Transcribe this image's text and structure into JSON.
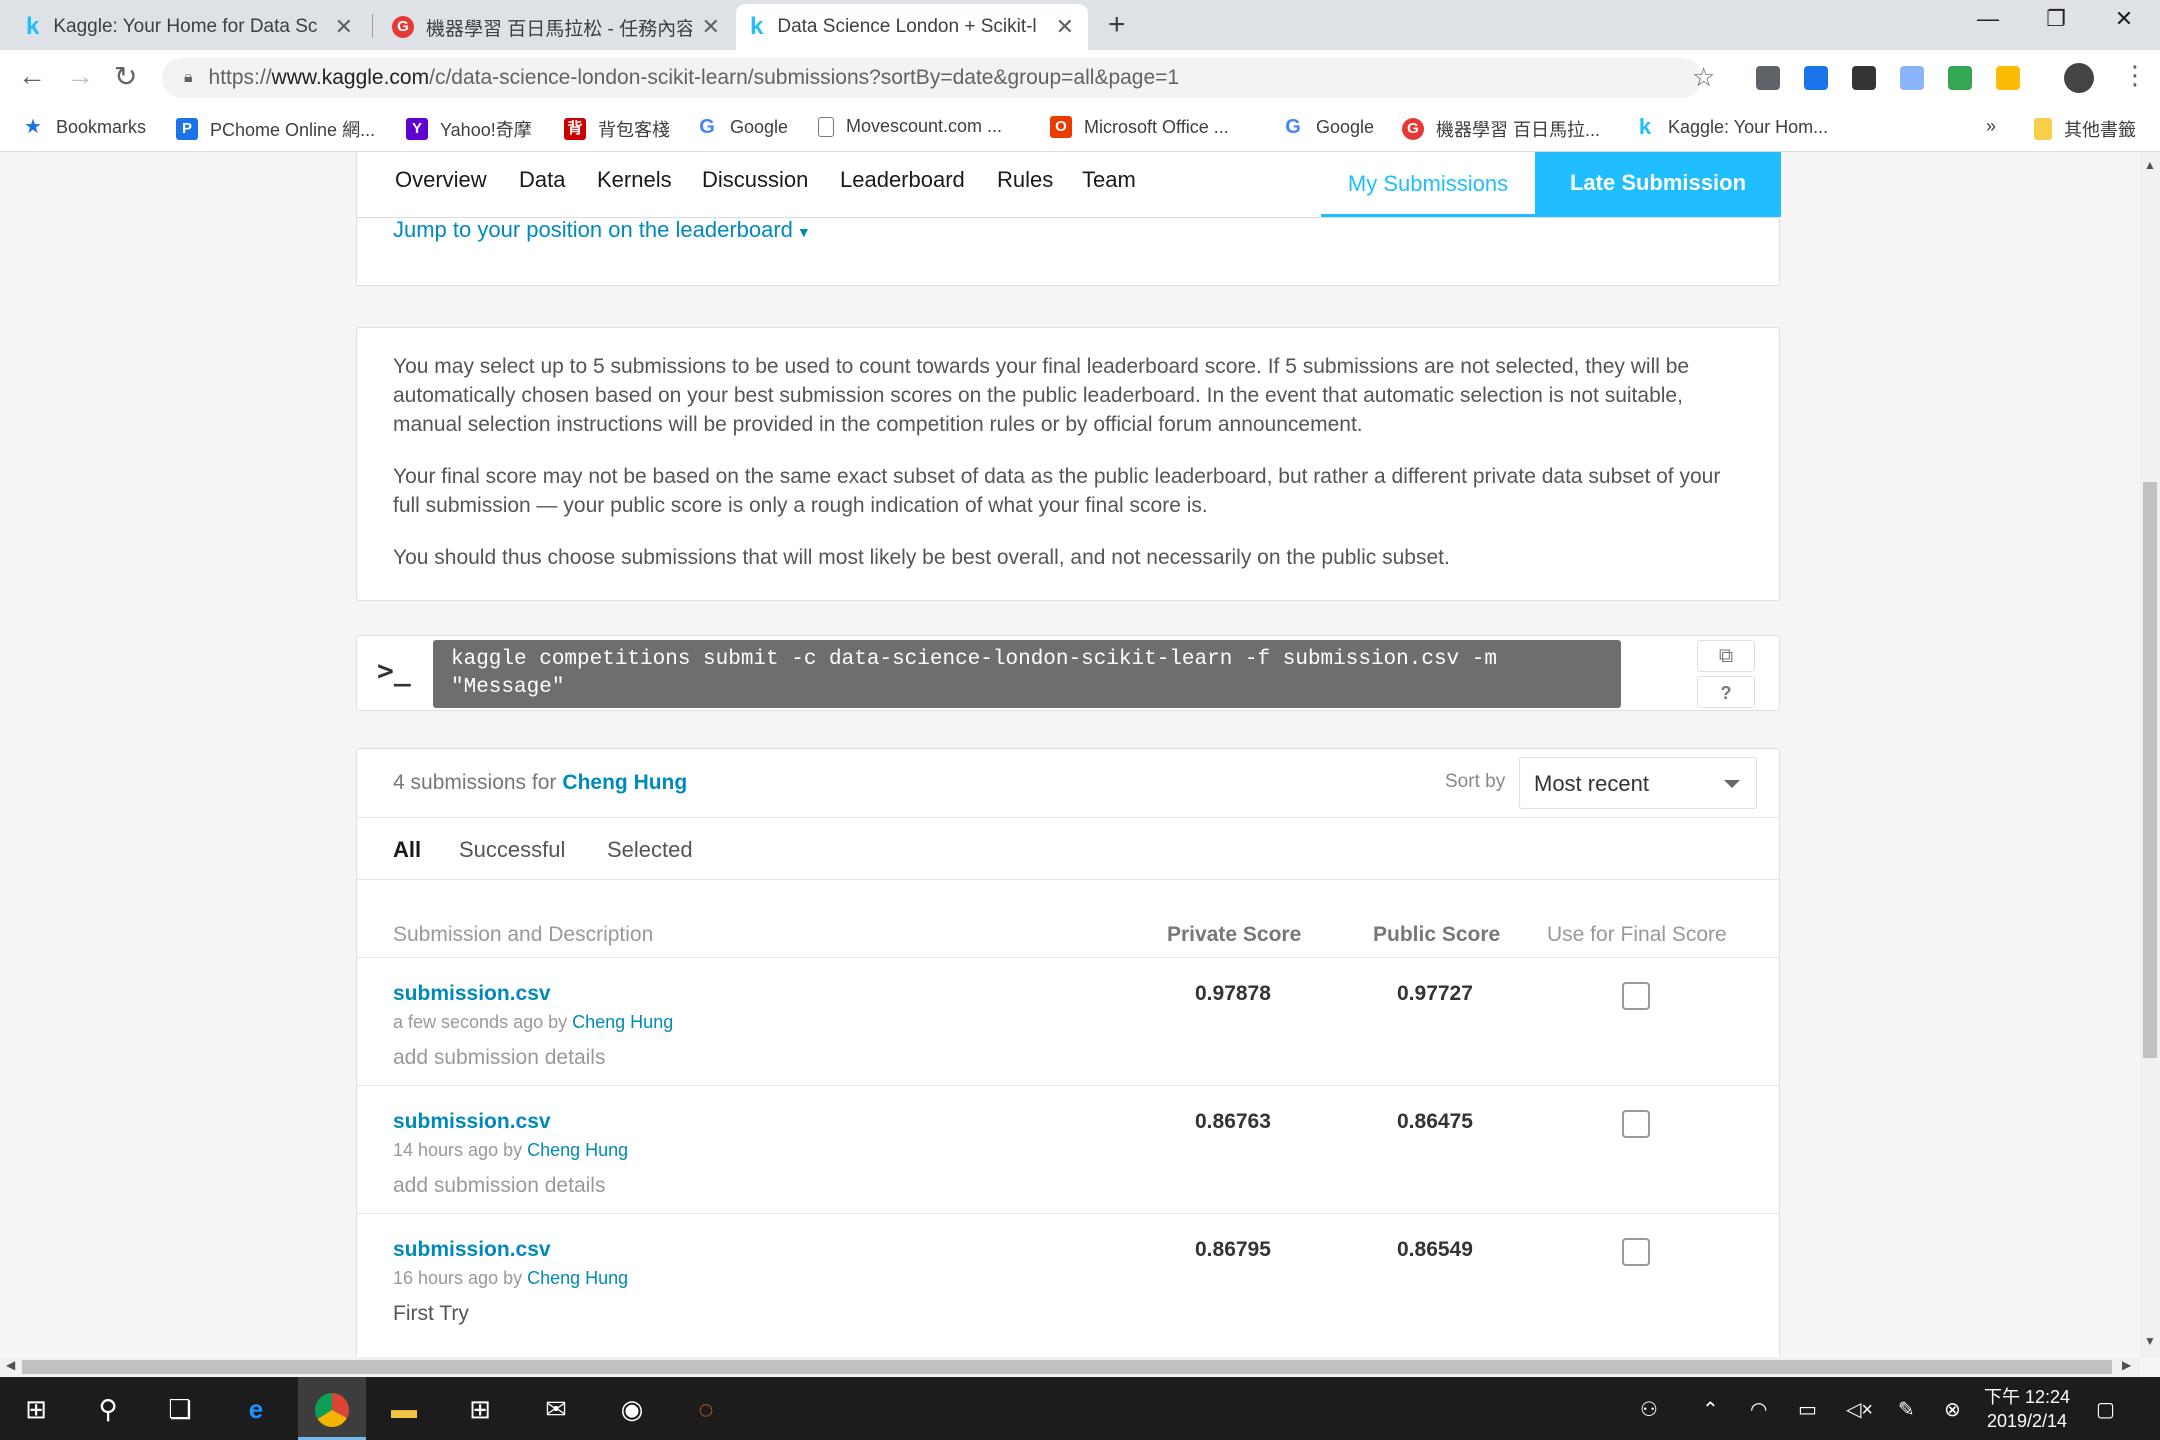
{
  "browser": {
    "tabs": [
      {
        "title": "Kaggle: Your Home for Data Sc",
        "favicon": "kaggle-icon"
      },
      {
        "title": "機器學習 百日馬拉松 - 任務內容",
        "favicon": "cupoy-icon"
      },
      {
        "title": "Data Science London + Scikit-l",
        "favicon": "kaggle-icon",
        "active": true
      }
    ],
    "url_prefix": "https://",
    "url_host": "www.kaggle.com",
    "url_path": "/c/data-science-london-scikit-learn/submissions?sortBy=date&group=all&page=1",
    "bookmarks": [
      {
        "label": "Bookmarks",
        "icon": "star-icon"
      },
      {
        "label": "PChome Online 網...",
        "icon": "pchome-icon"
      },
      {
        "label": "Yahoo!奇摩",
        "icon": "yahoo-icon"
      },
      {
        "label": "背包客棧",
        "icon": "backpackers-icon"
      },
      {
        "label": "Google",
        "icon": "google-icon"
      },
      {
        "label": "Movescount.com ...",
        "icon": "page-icon"
      },
      {
        "label": "Microsoft Office ...",
        "icon": "office-icon"
      },
      {
        "label": "Google",
        "icon": "google-icon"
      },
      {
        "label": "機器學習 百日馬拉...",
        "icon": "cupoy-icon"
      },
      {
        "label": "Kaggle: Your Hom...",
        "icon": "kaggle-icon"
      }
    ],
    "bookmarks_overflow": "»",
    "other_bookmarks": "其他書籤"
  },
  "competition_nav": {
    "items": [
      "Overview",
      "Data",
      "Kernels",
      "Discussion",
      "Leaderboard",
      "Rules",
      "Team"
    ],
    "my_submissions": "My Submissions",
    "late_submission": "Late Submission",
    "jump_link": "Jump to your position on the leaderboard"
  },
  "info": {
    "p1": "You may select up to 5 submissions to be used to count towards your final leaderboard score. If 5 submissions are not selected, they will be automatically chosen based on your best submission scores on the public leaderboard. In the event that automatic selection is not suitable, manual selection instructions will be provided in the competition rules or by official forum announcement.",
    "p2": "Your final score may not be based on the same exact subset of data as the public leaderboard, but rather a different private data subset of your full submission — your public score is only a rough indication of what your final score is.",
    "p3": "You should thus choose submissions that will most likely be best overall, and not necessarily on the public subset."
  },
  "cli": {
    "prompt": ">_",
    "command": "kaggle competitions submit -c data-science-london-scikit-learn -f submission.csv -m \"Message\"",
    "help": "?"
  },
  "submissions": {
    "count_text": "4 submissions for",
    "user": "Cheng Hung",
    "sort_label": "Sort by",
    "sort_value": "Most recent",
    "filters": [
      "All",
      "Successful",
      "Selected"
    ],
    "columns": {
      "desc": "Submission and Description",
      "private": "Private Score",
      "public": "Public Score",
      "final": "Use for Final Score"
    },
    "rows": [
      {
        "file": "submission.csv",
        "time": "a few seconds ago by",
        "user": "Cheng Hung",
        "description": "add submission details",
        "private": "0.97878",
        "public": "0.97727"
      },
      {
        "file": "submission.csv",
        "time": "14 hours ago by",
        "user": "Cheng Hung",
        "description": "add submission details",
        "private": "0.86763",
        "public": "0.86475"
      },
      {
        "file": "submission.csv",
        "time": "16 hours ago by",
        "user": "Cheng Hung",
        "description": "First Try",
        "private": "0.86795",
        "public": "0.86549"
      }
    ]
  },
  "taskbar": {
    "time": "下午 12:24",
    "date": "2019/2/14"
  },
  "colors": {
    "kaggle_blue": "#20beff",
    "link_blue": "#008abc"
  }
}
